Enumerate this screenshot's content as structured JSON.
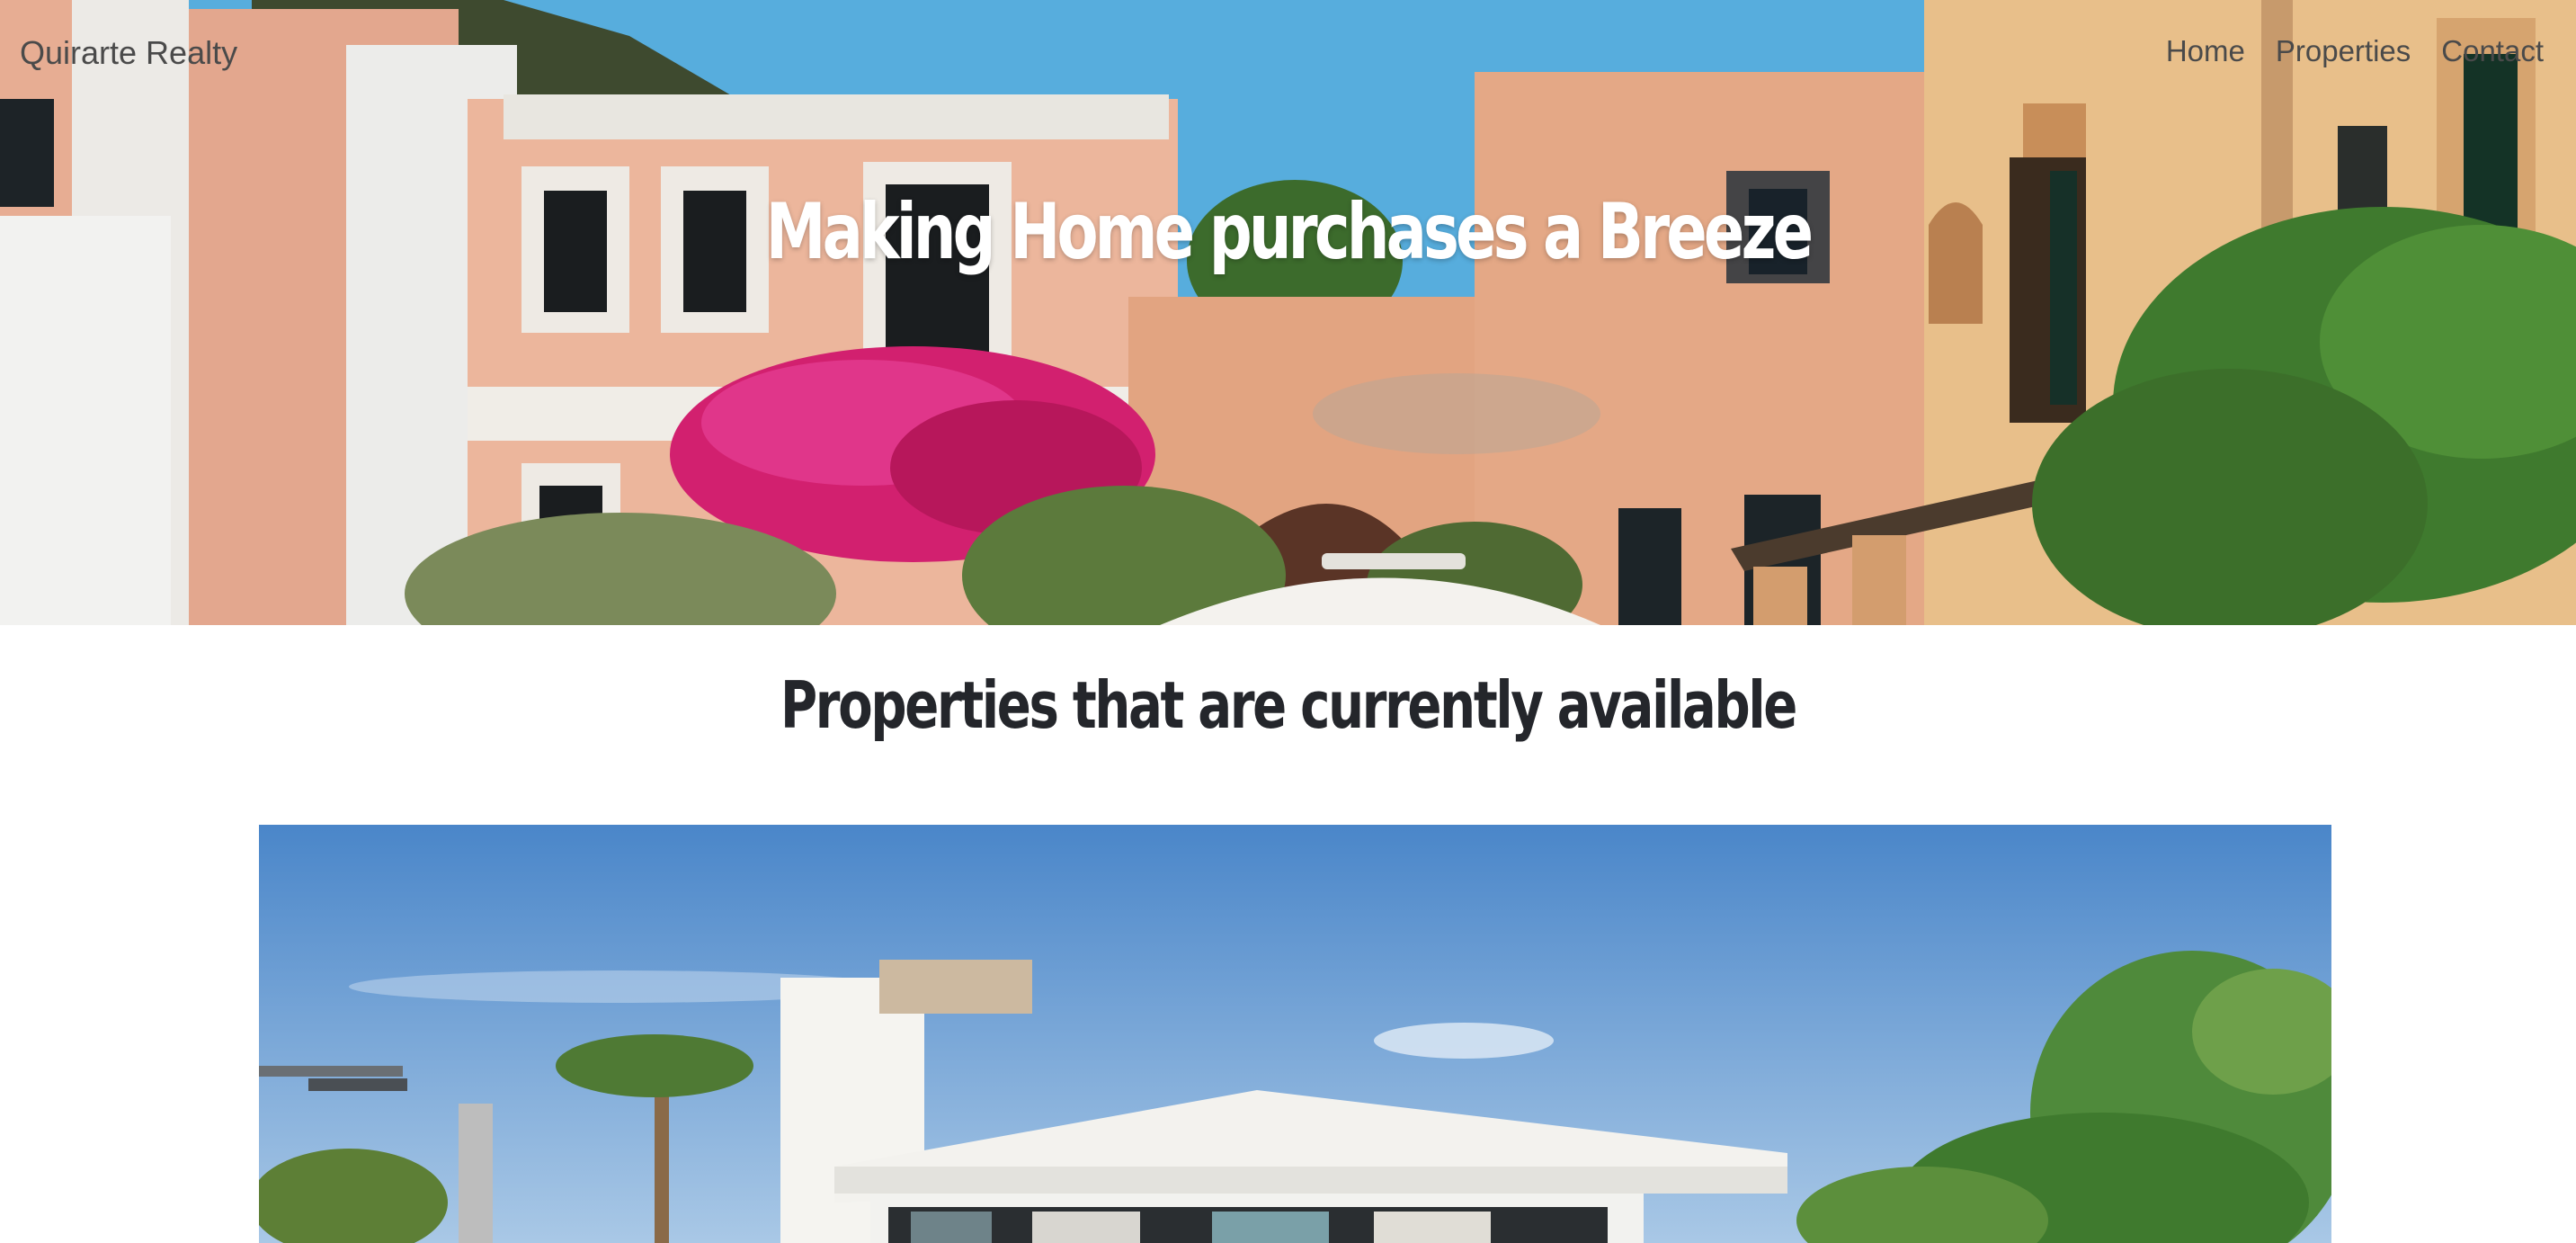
{
  "nav": {
    "brand": "Quirarte Realty",
    "links": [
      "Home",
      "Properties",
      "Contact"
    ]
  },
  "hero": {
    "title": "Making Home purchases a Breeze"
  },
  "listings": {
    "heading": "Properties that are currently available"
  },
  "colors": {
    "sky": "#5aaede",
    "wall_pink": "#e7ad93",
    "wall_peach": "#e0a07e",
    "wall_yellow": "#e9c28d",
    "bougainvillea": "#d8287a",
    "heading_text": "#24262b",
    "nav_text": "#4a4a4a"
  }
}
